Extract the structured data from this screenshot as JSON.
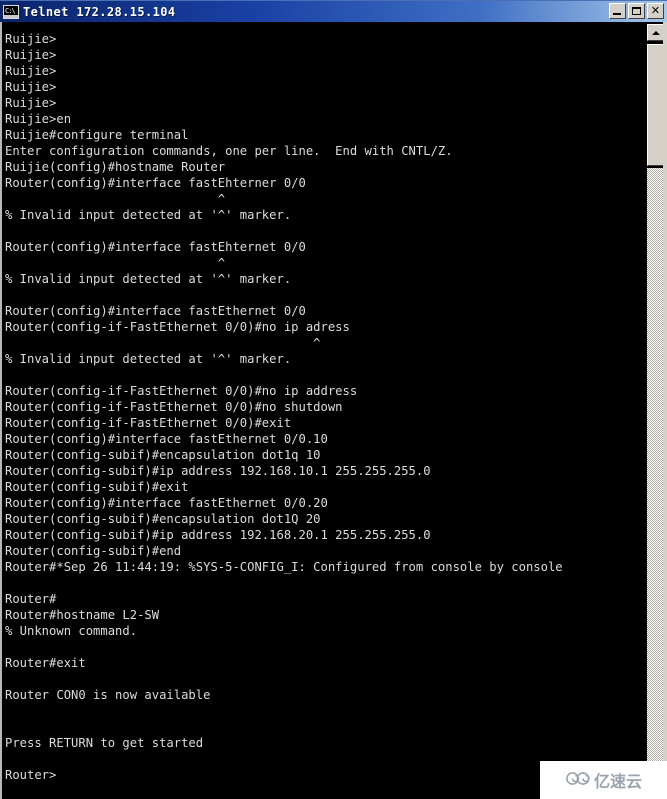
{
  "window": {
    "title": "Telnet  172.28.15.104",
    "icon_name": "telnet-console-icon",
    "icon_glyph": "C:\\",
    "buttons": {
      "minimize_label": "Minimize",
      "maximize_label": "Maximize",
      "close_label": "Close",
      "close_glyph": "✕"
    }
  },
  "terminal": {
    "background_color": "#000000",
    "text_color": "#dcdcdc",
    "lines": [
      "Ruijie>",
      "Ruijie>",
      "Ruijie>",
      "Ruijie>",
      "Ruijie>",
      "Ruijie>en",
      "Ruijie#configure terminal",
      "Enter configuration commands, one per line.  End with CNTL/Z.",
      "Ruijie(config)#hostname Router",
      "Router(config)#interface fastEhterner 0/0",
      "                             ^",
      "% Invalid input detected at '^' marker.",
      "",
      "Router(config)#interface fastEhternet 0/0",
      "                             ^",
      "% Invalid input detected at '^' marker.",
      "",
      "Router(config)#interface fastEthernet 0/0",
      "Router(config-if-FastEthernet 0/0)#no ip adress",
      "                                          ^",
      "% Invalid input detected at '^' marker.",
      "",
      "Router(config-if-FastEthernet 0/0)#no ip address",
      "Router(config-if-FastEthernet 0/0)#no shutdown",
      "Router(config-if-FastEthernet 0/0)#exit",
      "Router(config)#interface fastEthernet 0/0.10",
      "Router(config-subif)#encapsulation dot1q 10",
      "Router(config-subif)#ip address 192.168.10.1 255.255.255.0",
      "Router(config-subif)#exit",
      "Router(config)#interface fastEthernet 0/0.20",
      "Router(config-subif)#encapsulation dot1Q 20",
      "Router(config-subif)#ip address 192.168.20.1 255.255.255.0",
      "Router(config-subif)#end",
      "Router#*Sep 26 11:44:19: %SYS-5-CONFIG_I: Configured from console by console",
      "",
      "Router#",
      "Router#hostname L2-SW",
      "% Unknown command.",
      "",
      "Router#exit",
      "",
      "Router CON0 is now available",
      "",
      "",
      "Press RETURN to get started",
      "",
      "Router>"
    ]
  },
  "scrollbar": {
    "up_arrow_name": "scroll-up-arrow",
    "thumb_name": "scroll-thumb",
    "track_name": "scroll-track"
  },
  "watermark": {
    "text": "亿速云",
    "icon_name": "cloud-icon",
    "color": "#9aa3ae"
  }
}
